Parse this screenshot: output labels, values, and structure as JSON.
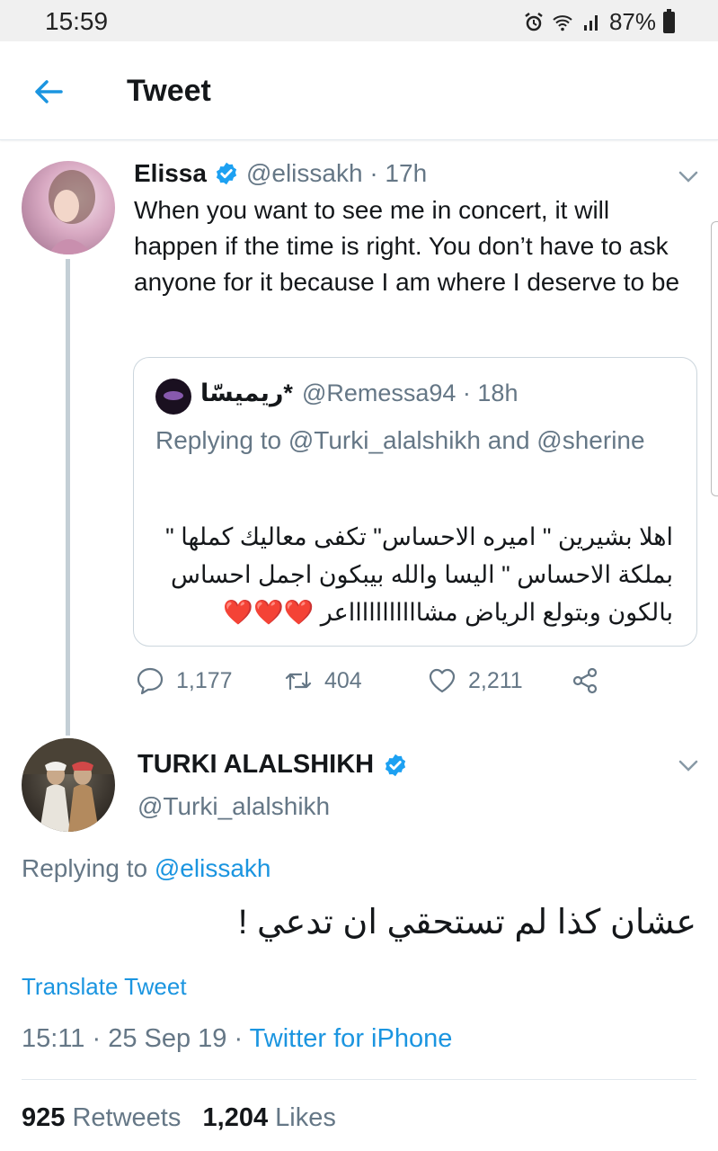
{
  "status_bar": {
    "time": "15:59",
    "battery": "87%"
  },
  "header": {
    "title": "Tweet"
  },
  "tweet1": {
    "name": "Elissa",
    "handle_time": "@elissakh · 17h",
    "text": "When you want to see me in concert, it will happen if the time is right. You don’t have to ask anyone for it because I am where I deserve to be",
    "quote": {
      "name": "ريميسّا*",
      "handle_time": "@Remessa94 · 18h",
      "replying_prefix": "Replying to ",
      "replying_user1": "@Turki_alalshikh",
      "replying_and": " and ",
      "replying_user2": "@sherine",
      "text": "اهلا بشيرين \" اميره الاحساس\" تكفى معاليك كملها \" بملكة الاحساس \" اليسا والله بيبكون اجمل احساس بالكون وبتولع الرياض مشاااااااااااعر",
      "hearts": "❤️❤️❤️"
    },
    "actions": {
      "replies": "1,177",
      "retweets": "404",
      "likes": "2,211"
    }
  },
  "tweet2": {
    "name": "TURKI ALALSHIKH",
    "handle": "@Turki_alalshikh",
    "replying_prefix": "Replying to ",
    "replying_user": "@elissakh",
    "text": "عشان كذا لم تستحقي ان تدعي !",
    "translate": "Translate Tweet",
    "timestamp": "15:11 · 25 Sep 19 · ",
    "source": "Twitter for iPhone",
    "retweets_count": "925",
    "retweets_label": " Retweets",
    "likes_count": "1,204",
    "likes_label": " Likes"
  },
  "colors": {
    "accent": "#1b95e0",
    "secondary_text": "#657786",
    "heart": "#e0245e"
  }
}
